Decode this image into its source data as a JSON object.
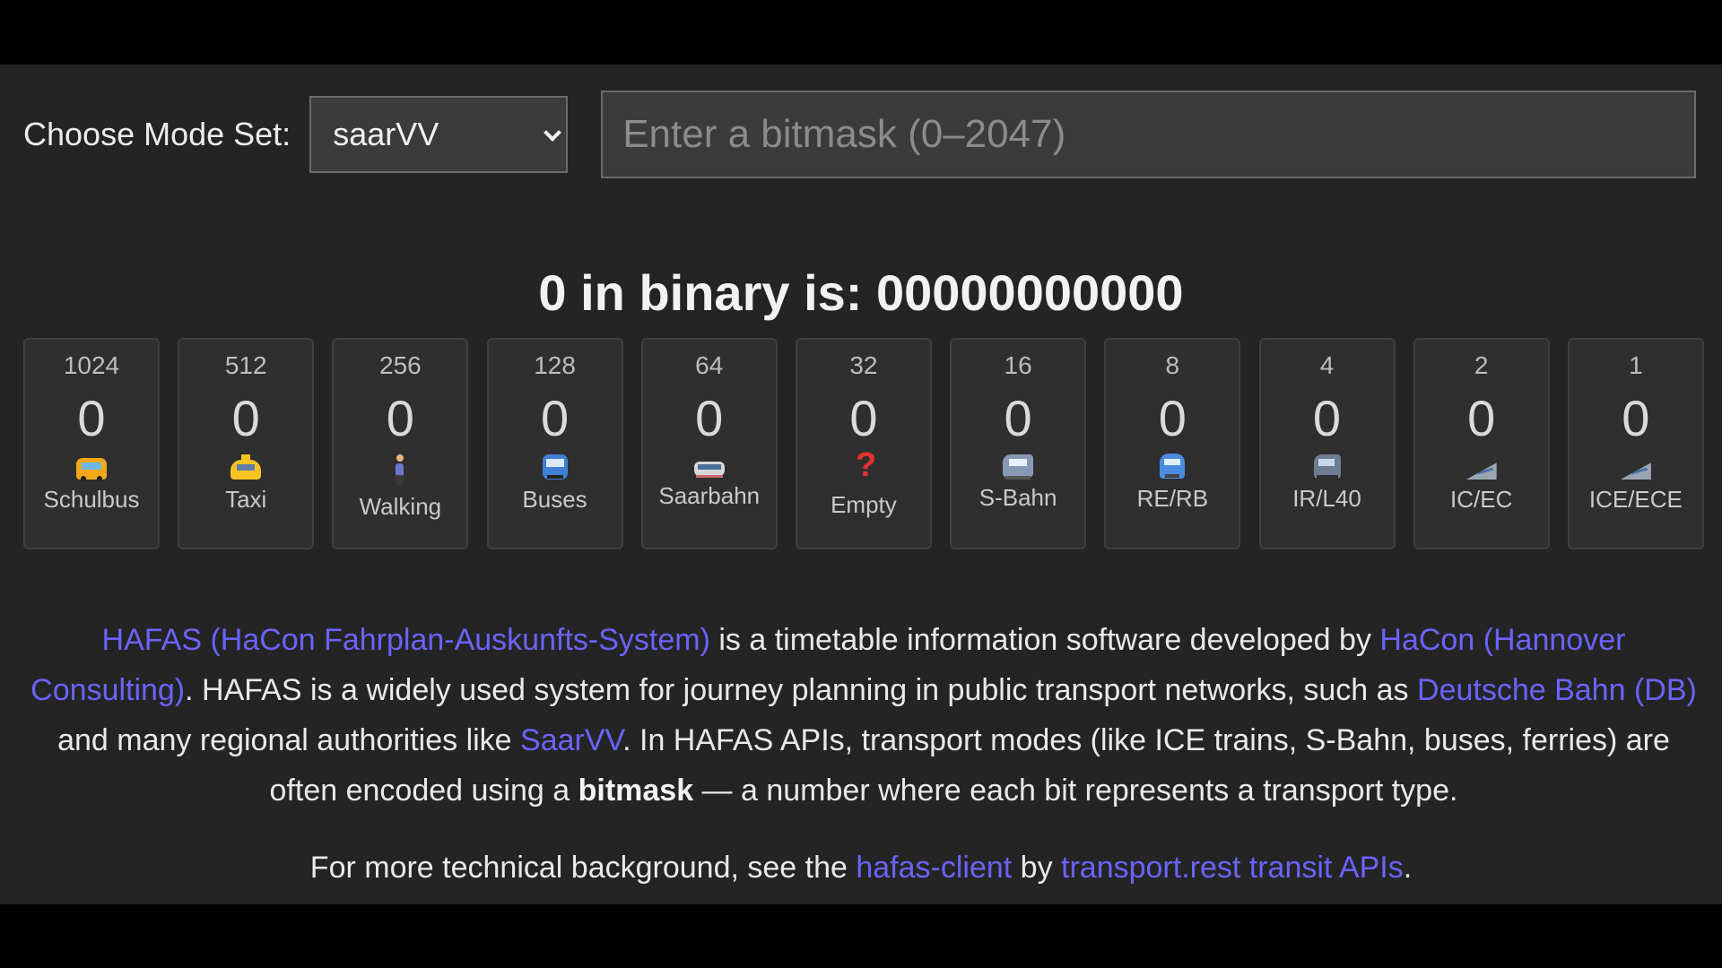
{
  "controls": {
    "mode_label": "Choose Mode Set:",
    "mode_select": {
      "selected": "saarVV"
    },
    "bitmask_input": {
      "value": "",
      "placeholder": "Enter a bitmask (0–2047)"
    }
  },
  "result": {
    "title": "0 in binary is: 00000000000"
  },
  "bits": [
    {
      "value": "1024",
      "state": "0",
      "label": "Schulbus",
      "icon": "school-bus-icon"
    },
    {
      "value": "512",
      "state": "0",
      "label": "Taxi",
      "icon": "taxi-icon"
    },
    {
      "value": "256",
      "state": "0",
      "label": "Walking",
      "icon": "walking-person-icon"
    },
    {
      "value": "128",
      "state": "0",
      "label": "Buses",
      "icon": "bus-icon"
    },
    {
      "value": "64",
      "state": "0",
      "label": "Saarbahn",
      "icon": "tram-icon"
    },
    {
      "value": "32",
      "state": "0",
      "label": "Empty",
      "icon": "question-mark-icon"
    },
    {
      "value": "16",
      "state": "0",
      "label": "S-Bahn",
      "icon": "s-bahn-train-icon"
    },
    {
      "value": "8",
      "state": "0",
      "label": "RE/RB",
      "icon": "regional-train-icon"
    },
    {
      "value": "4",
      "state": "0",
      "label": "IR/L40",
      "icon": "intercity-train-icon"
    },
    {
      "value": "2",
      "state": "0",
      "label": "IC/EC",
      "icon": "high-speed-train-icon"
    },
    {
      "value": "1",
      "state": "0",
      "label": "ICE/ECE",
      "icon": "high-speed-train-icon"
    }
  ],
  "description": {
    "link_hafas": "HAFAS (HaCon Fahrplan-Auskunfts-System)",
    "text_1": " is a timetable information software developed by ",
    "link_hacon": "HaCon (Hannover Consulting)",
    "text_2": ". HAFAS is a widely used system for journey planning in public transport networks, such as ",
    "link_db": "Deutsche Bahn (DB)",
    "text_3": " and many regional authorities like ",
    "link_saarvv": "SaarVV",
    "text_4": ". In HAFAS APIs, transport modes (like ICE trains, S-Bahn, buses, ferries) are often encoded using a ",
    "bold": "bitmask",
    "text_5": " — a number where each bit represents a transport type."
  },
  "footer": {
    "text_1": "For more technical background, see the ",
    "link_client": "hafas-client",
    "text_2": " by ",
    "link_transport": "transport.rest transit APIs",
    "text_3": "."
  },
  "colors": {
    "page_background": "#000000",
    "panel_background": "#242424",
    "link": "#6a63ff"
  }
}
